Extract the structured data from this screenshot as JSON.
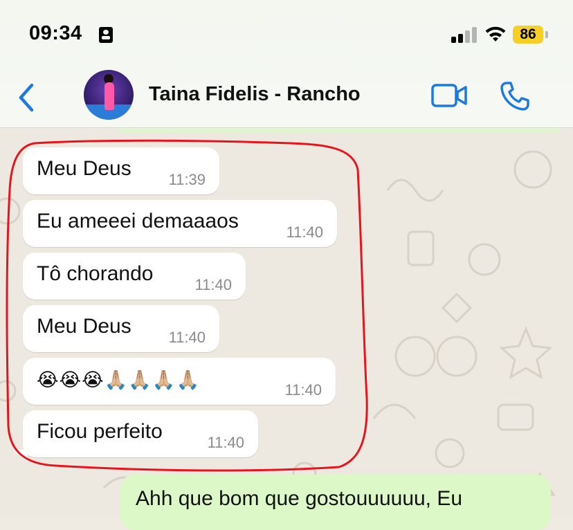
{
  "status_bar": {
    "time": "09:34",
    "battery": "86",
    "signal_bars_active": 2,
    "signal_bars_total": 4
  },
  "header": {
    "contact_name": "Taina Fidelis - Rancho"
  },
  "messages": [
    {
      "text": "Meu Deus",
      "time": "11:39",
      "direction": "incoming"
    },
    {
      "text": "Eu ameeei demaaaos",
      "time": "11:40",
      "direction": "incoming"
    },
    {
      "text": "Tô chorando",
      "time": "11:40",
      "direction": "incoming"
    },
    {
      "text": "Meu Deus",
      "time": "11:40",
      "direction": "incoming"
    },
    {
      "text": "😭😭😭🙏🏼🙏🏼🙏🏼🙏🏼",
      "time": "11:40",
      "direction": "incoming"
    },
    {
      "text": "Ficou perfeito",
      "time": "11:40",
      "direction": "incoming"
    }
  ],
  "outgoing_partial": {
    "text": "Ahh que bom que gostouuuuuu, Eu"
  },
  "colors": {
    "accent_blue": "#1a7ae0",
    "incoming_bubble": "#ffffff",
    "outgoing_bubble": "#dcf8c6",
    "battery_yellow": "#f5cf25",
    "annotation_red": "#e8141c"
  },
  "icons": [
    "id-card-icon",
    "signal-icon",
    "wifi-icon",
    "battery-icon",
    "chevron-left-icon",
    "video-camera-icon",
    "phone-icon"
  ]
}
